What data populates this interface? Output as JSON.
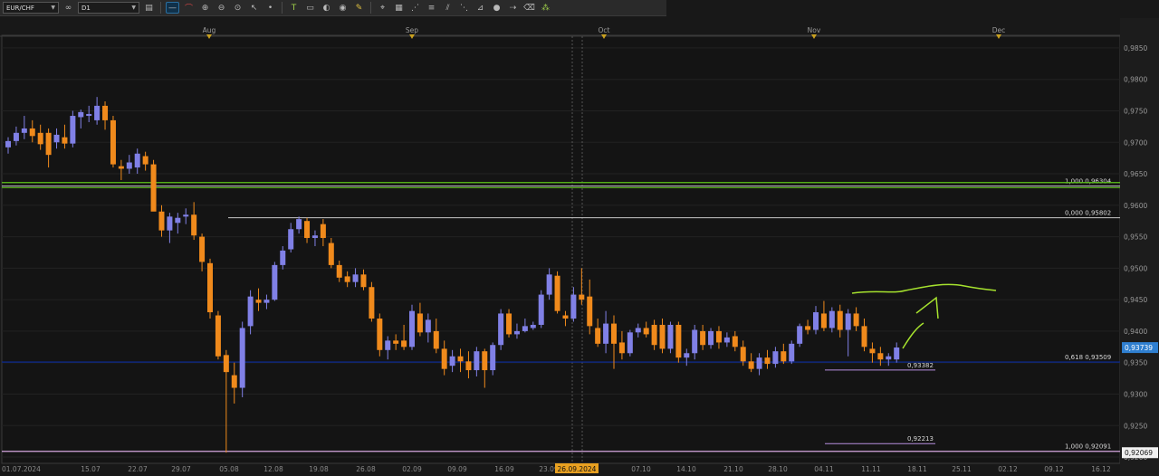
{
  "toolbar": {
    "symbol": "EUR/CHF",
    "timeframe": "D1",
    "icons": [
      "chart-type-icon",
      "link-icon",
      "line-tool-icon",
      "curve-tool-icon",
      "zoom-in-icon",
      "zoom-out-icon",
      "cursor-icon",
      "dot-icon",
      "text-tool-icon",
      "note-icon",
      "shapes-icon",
      "fill-icon",
      "pencil-icon",
      "pin-icon",
      "table-icon",
      "rays-icon",
      "fibonacci-icon",
      "channel-icon",
      "fan-icon",
      "gann-icon",
      "sphere-icon",
      "arrow-icon",
      "eraser-icon",
      "levels-icon"
    ]
  },
  "colors": {
    "background": "#141414",
    "bull_candle": "#8080e6",
    "bear_candle": "#f08a1c",
    "fib_line": "#c8c8c8",
    "support_line": "#0a2a9c",
    "green_line": "#5cc41a",
    "pink_line": "#d6a6e0",
    "lilac_line": "#b78ee0",
    "annotation": "#a6e22e",
    "current_price_bg": "#2f7fd0"
  },
  "chart_data": {
    "type": "candlestick",
    "symbol": "EUR/CHF",
    "timeframe": "D1",
    "ylim": [
      0.919,
      0.987
    ],
    "y_ticks": [
      "0,9850",
      "0,9800",
      "0,9750",
      "0,9700",
      "0,9650",
      "0,9600",
      "0,9550",
      "0,9500",
      "0,9450",
      "0,9400",
      "0,9350",
      "0,9300",
      "0,9250",
      "0,9200"
    ],
    "x_tick_labels": [
      "01.07.2024",
      "15.07",
      "22.07",
      "29.07",
      "05.08",
      "12.08",
      "19.08",
      "26.08",
      "02.09",
      "09.09",
      "16.09",
      "23.09",
      "07.10",
      "14.10",
      "21.10",
      "28.10",
      "04.11",
      "11.11",
      "18.11",
      "25.11",
      "02.12",
      "09.12",
      "16.12"
    ],
    "month_markers": [
      "Aug",
      "Sep",
      "Oct",
      "Nov",
      "Dec"
    ],
    "crosshair_label": "26.09.2024",
    "current_price": "0,93739",
    "bottom_price_label": "0,92069",
    "candles": [
      [
        0.9692,
        0.9708,
        0.9682,
        0.9702
      ],
      [
        0.9702,
        0.9725,
        0.9695,
        0.9715
      ],
      [
        0.9715,
        0.9742,
        0.9705,
        0.9722
      ],
      [
        0.9722,
        0.9735,
        0.97,
        0.971
      ],
      [
        0.9715,
        0.9728,
        0.9688,
        0.9697
      ],
      [
        0.9715,
        0.9722,
        0.966,
        0.968
      ],
      [
        0.97,
        0.9722,
        0.969,
        0.9712
      ],
      [
        0.9708,
        0.9728,
        0.969,
        0.9698
      ],
      [
        0.9698,
        0.975,
        0.9692,
        0.9742
      ],
      [
        0.974,
        0.9752,
        0.9722,
        0.9748
      ],
      [
        0.9742,
        0.9758,
        0.9732,
        0.9745
      ],
      [
        0.9735,
        0.9772,
        0.9728,
        0.9758
      ],
      [
        0.9758,
        0.9765,
        0.972,
        0.9735
      ],
      [
        0.9735,
        0.9742,
        0.966,
        0.9665
      ],
      [
        0.9662,
        0.9672,
        0.964,
        0.9658
      ],
      [
        0.9658,
        0.968,
        0.965,
        0.9668
      ],
      [
        0.966,
        0.969,
        0.965,
        0.9682
      ],
      [
        0.9678,
        0.9685,
        0.9655,
        0.9665
      ],
      [
        0.9665,
        0.9672,
        0.96,
        0.959
      ],
      [
        0.959,
        0.96,
        0.955,
        0.956
      ],
      [
        0.956,
        0.9588,
        0.954,
        0.9582
      ],
      [
        0.9572,
        0.9588,
        0.9555,
        0.958
      ],
      [
        0.9582,
        0.9595,
        0.957,
        0.9585
      ],
      [
        0.9585,
        0.9605,
        0.9545,
        0.9552
      ],
      [
        0.955,
        0.9555,
        0.9495,
        0.951
      ],
      [
        0.9508,
        0.9515,
        0.942,
        0.943
      ],
      [
        0.9425,
        0.9432,
        0.9355,
        0.936
      ],
      [
        0.9362,
        0.937,
        0.9207,
        0.9335
      ],
      [
        0.933,
        0.935,
        0.9285,
        0.931
      ],
      [
        0.931,
        0.9415,
        0.9295,
        0.9405
      ],
      [
        0.9408,
        0.9465,
        0.9395,
        0.9455
      ],
      [
        0.945,
        0.9468,
        0.9432,
        0.9445
      ],
      [
        0.9445,
        0.9458,
        0.9435,
        0.945
      ],
      [
        0.945,
        0.951,
        0.9448,
        0.9505
      ],
      [
        0.9505,
        0.9535,
        0.9498,
        0.9528
      ],
      [
        0.953,
        0.9572,
        0.9525,
        0.9562
      ],
      [
        0.9562,
        0.9582,
        0.9555,
        0.9578
      ],
      [
        0.9575,
        0.958,
        0.954,
        0.9548
      ],
      [
        0.9548,
        0.956,
        0.9535,
        0.9552
      ],
      [
        0.957,
        0.9578,
        0.9535,
        0.9548
      ],
      [
        0.954,
        0.9548,
        0.95,
        0.9505
      ],
      [
        0.9505,
        0.9512,
        0.9478,
        0.9485
      ],
      [
        0.9487,
        0.9495,
        0.947,
        0.9478
      ],
      [
        0.9478,
        0.95,
        0.947,
        0.949
      ],
      [
        0.949,
        0.9498,
        0.9465,
        0.947
      ],
      [
        0.947,
        0.9478,
        0.9415,
        0.942
      ],
      [
        0.942,
        0.9428,
        0.936,
        0.937
      ],
      [
        0.937,
        0.9392,
        0.9355,
        0.9385
      ],
      [
        0.9385,
        0.9395,
        0.937,
        0.938
      ],
      [
        0.9385,
        0.941,
        0.937,
        0.9375
      ],
      [
        0.9375,
        0.9442,
        0.937,
        0.9432
      ],
      [
        0.9428,
        0.9445,
        0.9392,
        0.9398
      ],
      [
        0.9398,
        0.9428,
        0.9382,
        0.9418
      ],
      [
        0.94,
        0.942,
        0.9365,
        0.9372
      ],
      [
        0.9372,
        0.9385,
        0.933,
        0.934
      ],
      [
        0.9345,
        0.937,
        0.9335,
        0.936
      ],
      [
        0.936,
        0.9372,
        0.9335,
        0.9352
      ],
      [
        0.9352,
        0.9368,
        0.9325,
        0.9338
      ],
      [
        0.9338,
        0.9375,
        0.9328,
        0.9368
      ],
      [
        0.9368,
        0.9372,
        0.931,
        0.9338
      ],
      [
        0.9338,
        0.9382,
        0.933,
        0.9378
      ],
      [
        0.9378,
        0.9435,
        0.937,
        0.9428
      ],
      [
        0.9428,
        0.9435,
        0.939,
        0.9395
      ],
      [
        0.9395,
        0.9412,
        0.9388,
        0.94
      ],
      [
        0.94,
        0.942,
        0.9398,
        0.9408
      ],
      [
        0.9405,
        0.9415,
        0.9402,
        0.941
      ],
      [
        0.941,
        0.9465,
        0.9405,
        0.9458
      ],
      [
        0.9458,
        0.95,
        0.945,
        0.949
      ],
      [
        0.9488,
        0.9495,
        0.9428,
        0.9432
      ],
      [
        0.9425,
        0.9432,
        0.9408,
        0.942
      ],
      [
        0.942,
        0.947,
        0.9415,
        0.9458
      ],
      [
        0.9458,
        0.95,
        0.9442,
        0.945
      ],
      [
        0.9455,
        0.9482,
        0.9395,
        0.9408
      ],
      [
        0.9405,
        0.942,
        0.9375,
        0.938
      ],
      [
        0.938,
        0.9432,
        0.9365,
        0.9412
      ],
      [
        0.9412,
        0.9425,
        0.934,
        0.938
      ],
      [
        0.9382,
        0.94,
        0.9355,
        0.9365
      ],
      [
        0.9365,
        0.9402,
        0.936,
        0.9398
      ],
      [
        0.9398,
        0.9412,
        0.939,
        0.9405
      ],
      [
        0.9405,
        0.9415,
        0.939,
        0.9395
      ],
      [
        0.941,
        0.9418,
        0.937,
        0.9378
      ],
      [
        0.941,
        0.942,
        0.9365,
        0.9372
      ],
      [
        0.9372,
        0.9415,
        0.9365,
        0.941
      ],
      [
        0.941,
        0.9415,
        0.935,
        0.9358
      ],
      [
        0.9358,
        0.9372,
        0.9345,
        0.9365
      ],
      [
        0.9365,
        0.941,
        0.9355,
        0.9402
      ],
      [
        0.94,
        0.941,
        0.937,
        0.9378
      ],
      [
        0.9378,
        0.9405,
        0.9372,
        0.94
      ],
      [
        0.94,
        0.9408,
        0.9372,
        0.9382
      ],
      [
        0.9382,
        0.9398,
        0.9375,
        0.939
      ],
      [
        0.9392,
        0.94,
        0.9368,
        0.9375
      ],
      [
        0.9375,
        0.9385,
        0.9345,
        0.9352
      ],
      [
        0.9352,
        0.9365,
        0.9335,
        0.934
      ],
      [
        0.934,
        0.9365,
        0.933,
        0.9358
      ],
      [
        0.9358,
        0.937,
        0.934,
        0.9348
      ],
      [
        0.9348,
        0.9375,
        0.9342,
        0.9368
      ],
      [
        0.9368,
        0.938,
        0.9348,
        0.9352
      ],
      [
        0.9352,
        0.9385,
        0.9348,
        0.938
      ],
      [
        0.938,
        0.9412,
        0.9375,
        0.9408
      ],
      [
        0.9408,
        0.9418,
        0.9395,
        0.9402
      ],
      [
        0.9402,
        0.944,
        0.9395,
        0.943
      ],
      [
        0.9428,
        0.9448,
        0.94,
        0.9405
      ],
      [
        0.9405,
        0.9438,
        0.9398,
        0.9432
      ],
      [
        0.9432,
        0.9442,
        0.939,
        0.9402
      ],
      [
        0.9402,
        0.9435,
        0.936,
        0.9428
      ],
      [
        0.9428,
        0.9438,
        0.94,
        0.9408
      ],
      [
        0.9408,
        0.942,
        0.9368,
        0.9375
      ],
      [
        0.9372,
        0.9382,
        0.935,
        0.9365
      ],
      [
        0.9365,
        0.9375,
        0.9345,
        0.9355
      ],
      [
        0.9355,
        0.9365,
        0.9345,
        0.936
      ],
      [
        0.9355,
        0.9382,
        0.935,
        0.9374
      ]
    ],
    "horizontal_lines": [
      {
        "price": 0.96304,
        "label": "1,000 0,96304",
        "color_key": "fib_line"
      },
      {
        "price": 0.9636,
        "label": "",
        "color_key": "green_line"
      },
      {
        "price": 0.95802,
        "label": "0,000 0,95802",
        "color_key": "fib_line"
      },
      {
        "price": 0.93509,
        "label": "0,618 0,93509",
        "color_key": "support_line"
      },
      {
        "price": 0.93382,
        "label": "0,93382",
        "color_key": "lilac_line"
      },
      {
        "price": 0.92213,
        "label": "0,92213",
        "color_key": "lilac_line"
      },
      {
        "price": 0.92091,
        "label": "1,000 0,92091",
        "color_key": "pink_line"
      }
    ]
  }
}
